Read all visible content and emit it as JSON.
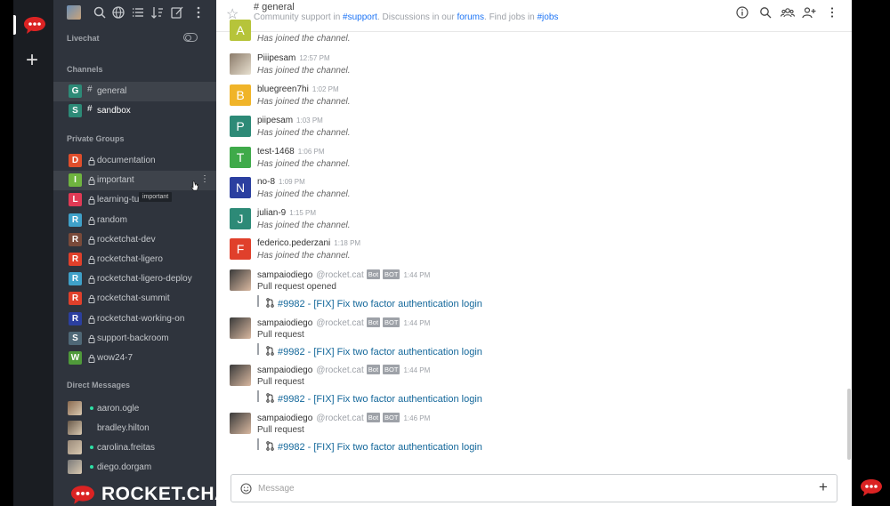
{
  "sidebar": {
    "livechat_label": "Livechat",
    "channels_label": "Channels",
    "private_groups_label": "Private Groups",
    "direct_messages_label": "Direct Messages",
    "channels": [
      {
        "letter": "G",
        "name": "general",
        "color": "#2d8a77"
      },
      {
        "letter": "S",
        "name": "sandbox",
        "color": "#2d8a77"
      }
    ],
    "groups": [
      {
        "letter": "D",
        "name": "documentation",
        "color": "#e04e2b"
      },
      {
        "letter": "I",
        "name": "important",
        "color": "#6fb43f"
      },
      {
        "letter": "L",
        "name": "learning-tu",
        "color": "#e03a55"
      },
      {
        "letter": "R",
        "name": "random",
        "color": "#3fa1c9"
      },
      {
        "letter": "R",
        "name": "rocketchat-dev",
        "color": "#7a4a3a"
      },
      {
        "letter": "R",
        "name": "rocketchat-ligero",
        "color": "#e0402b"
      },
      {
        "letter": "R",
        "name": "rocketchat-ligero-deploy",
        "color": "#3fa1c9"
      },
      {
        "letter": "R",
        "name": "rocketchat-summit",
        "color": "#e0402b"
      },
      {
        "letter": "R",
        "name": "rocketchat-working-on",
        "color": "#2b3fa0"
      },
      {
        "letter": "S",
        "name": "support-backroom",
        "color": "#4f6877"
      },
      {
        "letter": "W",
        "name": "wow24-7",
        "color": "#4f9a3a"
      }
    ],
    "tooltip": "important",
    "dms": [
      {
        "name": "aaron.ogle",
        "status": "#2de0a5"
      },
      {
        "name": "bradley.hilton",
        "status": "#2f343d"
      },
      {
        "name": "carolina.freitas",
        "status": "#2de0a5"
      },
      {
        "name": "diego.dorgam",
        "status": "#2de0a5"
      }
    ],
    "brand": "ROCKET.CHAT"
  },
  "header": {
    "title": "# general",
    "topic_prefix": "Community support in ",
    "topic_link1": "#support",
    "topic_mid": ". Discussions in our ",
    "topic_link2": "forums",
    "topic_mid2": ". Find jobs in ",
    "topic_link3": "#jobs"
  },
  "messages": [
    {
      "user": "",
      "time": "",
      "text": "Has joined the channel.",
      "letter": "A",
      "color": "#b6c43a"
    },
    {
      "user": "Piiipesam",
      "time": "12:57 PM",
      "text": "Has joined the channel.",
      "letter": "",
      "color": "#8b7b6a"
    },
    {
      "user": "bluegreen7hi",
      "time": "1:02 PM",
      "text": "Has joined the channel.",
      "letter": "B",
      "color": "#f0b429"
    },
    {
      "user": "piipesam",
      "time": "1:03 PM",
      "text": "Has joined the channel.",
      "letter": "P",
      "color": "#2d8a77"
    },
    {
      "user": "test-1468",
      "time": "1:06 PM",
      "text": "Has joined the channel.",
      "letter": "T",
      "color": "#3faa4a"
    },
    {
      "user": "no-8",
      "time": "1:09 PM",
      "text": "Has joined the channel.",
      "letter": "N",
      "color": "#2b3fa0"
    },
    {
      "user": "julian-9",
      "time": "1:15 PM",
      "text": "Has joined the channel.",
      "letter": "J",
      "color": "#2d8a77"
    },
    {
      "user": "federico.pederzani",
      "time": "1:18 PM",
      "text": "Has joined the channel.",
      "letter": "F",
      "color": "#e0402b"
    }
  ],
  "bot_messages": [
    {
      "user": "sampaiodiego",
      "alias": "@rocket.cat",
      "badge1": "Bot",
      "badge2": "BOT",
      "time": "1:44 PM",
      "text": "Pull request opened",
      "link": "#9982 - [FIX] Fix two factor authentication login"
    },
    {
      "user": "sampaiodiego",
      "alias": "@rocket.cat",
      "badge1": "Bot",
      "badge2": "BOT",
      "time": "1:44 PM",
      "text": "Pull request",
      "link": "#9982 - [FIX] Fix two factor authentication login"
    },
    {
      "user": "sampaiodiego",
      "alias": "@rocket.cat",
      "badge1": "Bot",
      "badge2": "BOT",
      "time": "1:44 PM",
      "text": "Pull request",
      "link": "#9982 - [FIX] Fix two factor authentication login"
    },
    {
      "user": "sampaiodiego",
      "alias": "@rocket.cat",
      "badge1": "Bot",
      "badge2": "BOT",
      "time": "1:46 PM",
      "text": "Pull request",
      "link": "#9982 - [FIX] Fix two factor authentication login"
    }
  ],
  "composer": {
    "placeholder": "Message"
  },
  "colors": {
    "brand_red": "#db2323",
    "link": "#13679a",
    "sidebar_bg": "#2f343d"
  }
}
